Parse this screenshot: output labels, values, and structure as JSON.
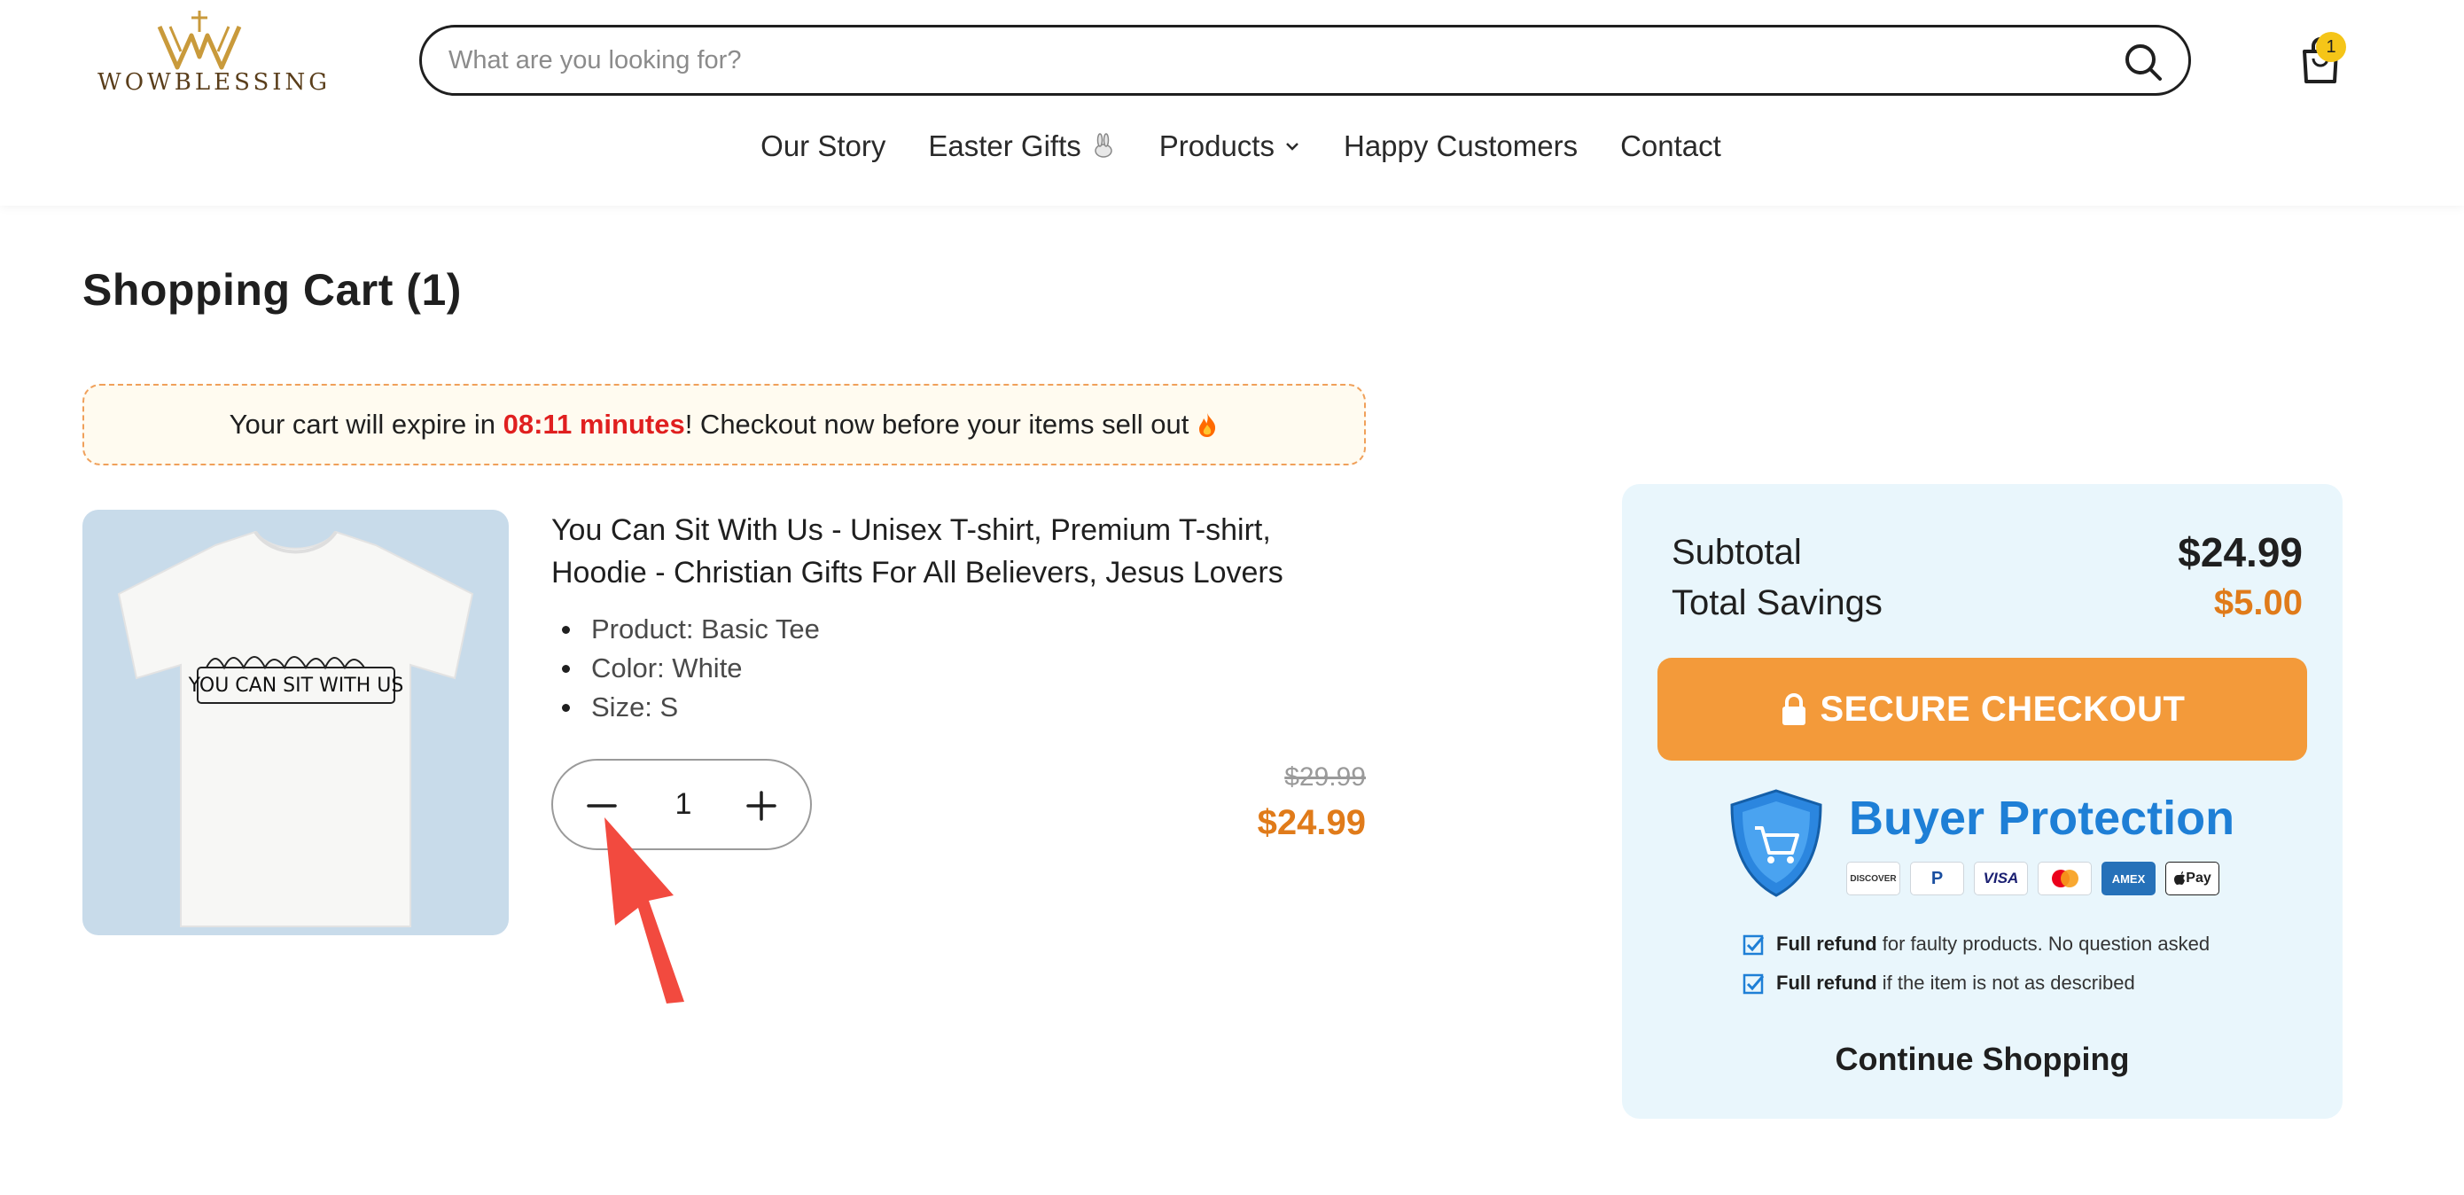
{
  "brand": {
    "name": "WOWBLESSING"
  },
  "search": {
    "placeholder": "What are you looking for?"
  },
  "cart": {
    "count": "1"
  },
  "nav": {
    "items": [
      {
        "label": "Our Story"
      },
      {
        "label": "Easter Gifts"
      },
      {
        "label": "Products"
      },
      {
        "label": "Happy Customers"
      },
      {
        "label": "Contact"
      }
    ]
  },
  "page": {
    "title": "Shopping Cart (1)"
  },
  "timer": {
    "prefix": "Your cart will expire in ",
    "time": "08:11 minutes",
    "suffix": "! Checkout now before your items sell out"
  },
  "product": {
    "title": "You Can Sit With Us - Unisex T-shirt, Premium T-shirt, Hoodie - Christian Gifts For All Believers, Jesus Lovers",
    "image_text": "YOU CAN SIT WITH US",
    "options": [
      "Product: Basic Tee",
      "Color: White",
      "Size: S"
    ],
    "quantity": "1",
    "old_price": "$29.99",
    "price": "$24.99"
  },
  "summary": {
    "subtotal_label": "Subtotal",
    "subtotal_value": "$24.99",
    "savings_label": "Total Savings",
    "savings_value": "$5.00",
    "checkout_label": "SECURE CHECKOUT",
    "protection_title": "Buyer Protection",
    "payment_methods": [
      "DISCOVER",
      "P",
      "VISA",
      "mastercard",
      "AMEX",
      "Pay"
    ],
    "guarantees": [
      {
        "bold": "Full refund",
        "text": " for faulty products. No question asked"
      },
      {
        "bold": "Full refund",
        "text": " if the item is not as described"
      }
    ],
    "continue_label": "Continue Shopping"
  },
  "colors": {
    "accent_orange": "#f39a3a",
    "price_orange": "#e07b1a",
    "timer_red": "#e01f1f",
    "protection_blue": "#1e7fd6",
    "summary_bg": "#e9f6fc",
    "annotation_arrow": "#f24a3f"
  }
}
